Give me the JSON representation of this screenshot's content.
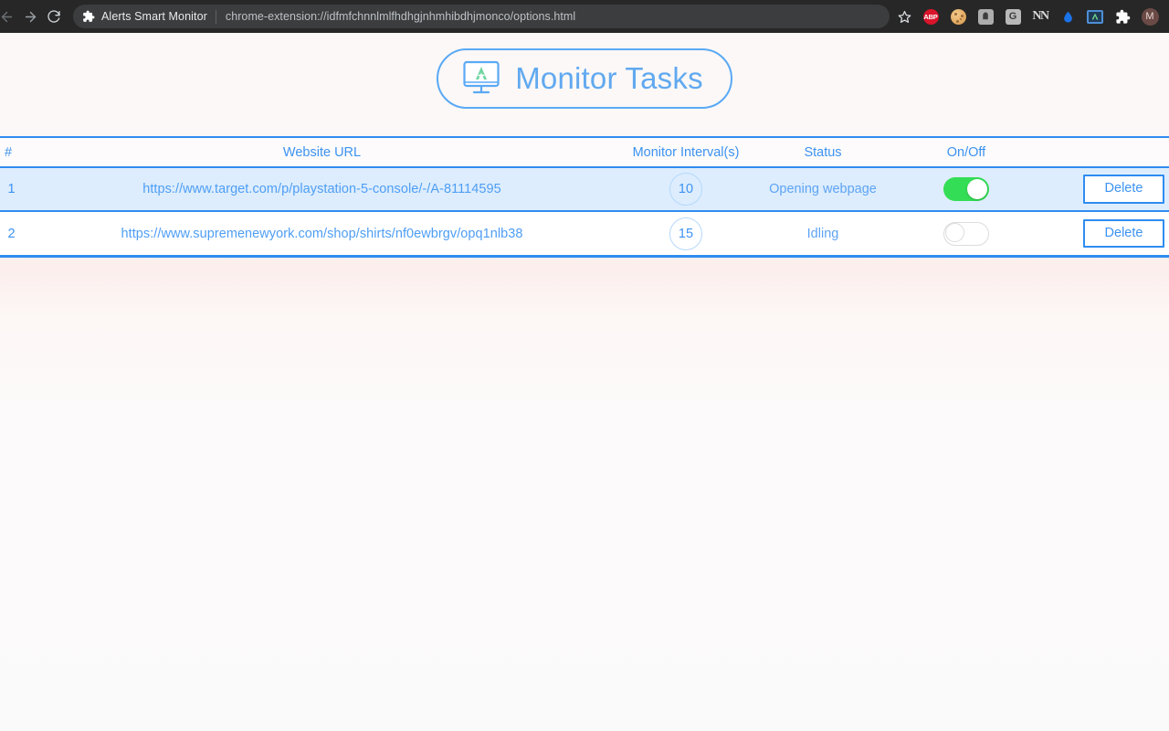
{
  "browser": {
    "nav": {
      "back_label": "Back",
      "forward_label": "Forward",
      "reload_label": "Reload"
    },
    "tab_title": "Alerts Smart Monitor",
    "url": "chrome-extension://idfmfchnnlmlfhdhgjnhmhibdhjmonco/options.html",
    "bookmark_label": "Bookmark this tab",
    "extension_icon": "puzzle-piece-icon",
    "toolbar_icons": [
      {
        "name": "adblock-plus-icon",
        "label": "ABP"
      },
      {
        "name": "cookie-icon",
        "label": ""
      },
      {
        "name": "ghostery-icon",
        "label": ""
      },
      {
        "name": "grammarly-icon",
        "label": "G"
      },
      {
        "name": "nordvpn-icon",
        "label": "NN"
      },
      {
        "name": "water-drop-icon",
        "label": ""
      },
      {
        "name": "alerts-smart-monitor-icon",
        "label": ""
      },
      {
        "name": "extensions-puzzle-icon",
        "label": ""
      },
      {
        "name": "profile-avatar",
        "label": "M"
      }
    ]
  },
  "header": {
    "title": "Monitor Tasks",
    "logo_icon": "monitor-display-icon",
    "accent_color": "#5aa9f5"
  },
  "table": {
    "columns": [
      {
        "key": "index",
        "label": "#"
      },
      {
        "key": "url",
        "label": "Website URL"
      },
      {
        "key": "interval",
        "label": "Monitor Interval(s)"
      },
      {
        "key": "status",
        "label": "Status"
      },
      {
        "key": "onoff",
        "label": "On/Off"
      },
      {
        "key": "action",
        "label": ""
      }
    ],
    "rows": [
      {
        "index": "1",
        "url": "https://www.target.com/p/playstation-5-console/-/A-81114595",
        "interval": "10",
        "status": "Opening webpage",
        "enabled": true,
        "delete_label": "Delete"
      },
      {
        "index": "2",
        "url": "https://www.supremenewyork.com/shop/shirts/nf0ewbrgv/opq1nlb38",
        "interval": "15",
        "status": "Idling",
        "enabled": false,
        "delete_label": "Delete"
      }
    ]
  },
  "colors": {
    "accent_blue": "#2f8cf0",
    "link_blue": "#4e9ef5",
    "toggle_on_green": "#33dd55",
    "toggle_off_grey": "#dcdcdc",
    "row_active_bg": "#ddedfd"
  }
}
